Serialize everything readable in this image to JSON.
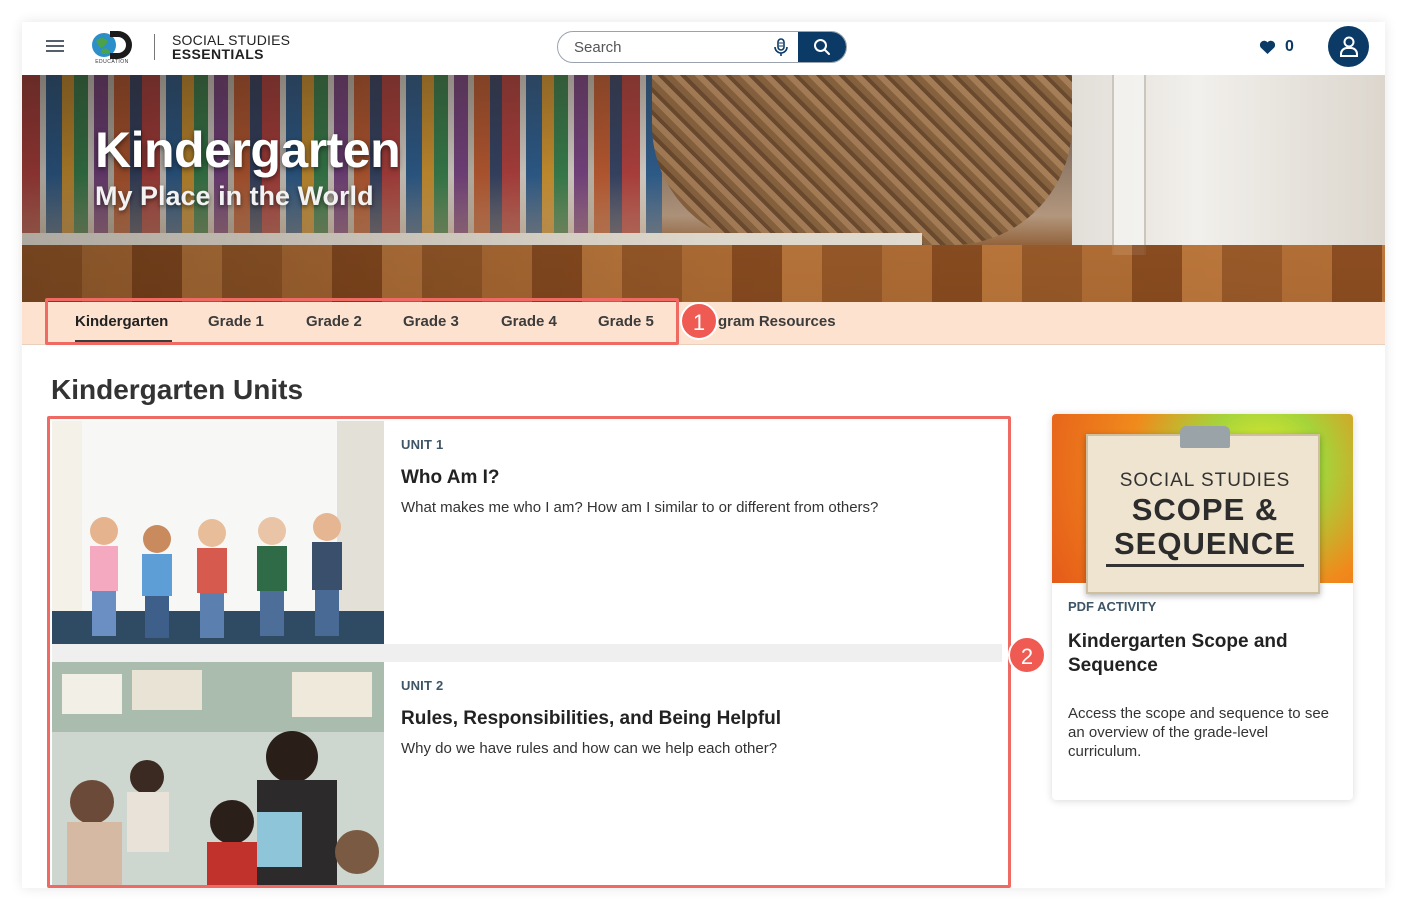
{
  "header": {
    "logo_caption": "EDUCATION",
    "brand_line1": "SOCIAL STUDIES",
    "brand_line2": "ESSENTIALS",
    "search": {
      "placeholder": "Search"
    },
    "favorites_count": "0"
  },
  "hero": {
    "title": "Kindergarten",
    "subtitle": "My Place in the World"
  },
  "grade_tabs": {
    "items": [
      {
        "label": "Kindergarten",
        "active": true
      },
      {
        "label": "Grade 1"
      },
      {
        "label": "Grade 2"
      },
      {
        "label": "Grade 3"
      },
      {
        "label": "Grade 4"
      },
      {
        "label": "Grade 5"
      }
    ],
    "overflow_label": "gram Resources"
  },
  "callouts": {
    "one": "1",
    "two": "2"
  },
  "units": {
    "heading": "Kindergarten Units",
    "items": [
      {
        "tag": "UNIT 1",
        "title": "Who Am I?",
        "description": "What makes me who I am? How am I similar to or different from others?"
      },
      {
        "tag": "UNIT 2",
        "title": "Rules, Responsibilities, and Being Helpful",
        "description": "Why do we have rules and how can we help each other?"
      }
    ]
  },
  "resource": {
    "image_line1": "SOCIAL STUDIES",
    "image_line2": "SCOPE &",
    "image_line3": "SEQUENCE",
    "tag": "PDF ACTIVITY",
    "title": "Kindergarten Scope and Sequence",
    "description": "Access the scope and sequence to see an overview of the grade-level curriculum."
  },
  "colors": {
    "navy": "#0b3a66",
    "tab_bar_bg": "#fde3cf",
    "callout_red": "#ef5a52"
  }
}
